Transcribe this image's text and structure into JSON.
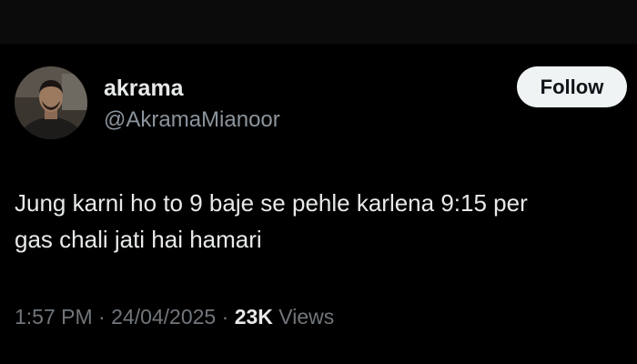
{
  "tweet": {
    "author": {
      "display_name": "akrama",
      "handle": "@AkramaMianoor",
      "avatar_icon": "user-photo-avatar"
    },
    "follow_label": "Follow",
    "text_lines": [
      "Jung karni ho to 9 baje se pehle karlena 9:15 per",
      "gas chali jati hai hamari"
    ],
    "time": "1:57 PM",
    "separator": "·",
    "date": "24/04/2025",
    "views_count": "23K",
    "views_label": "Views"
  },
  "colors": {
    "background": "#000000",
    "primary_text": "#e7e9ea",
    "secondary_text": "#71767b",
    "follow_button_bg": "#eff3f4",
    "follow_button_text": "#0f1419"
  }
}
